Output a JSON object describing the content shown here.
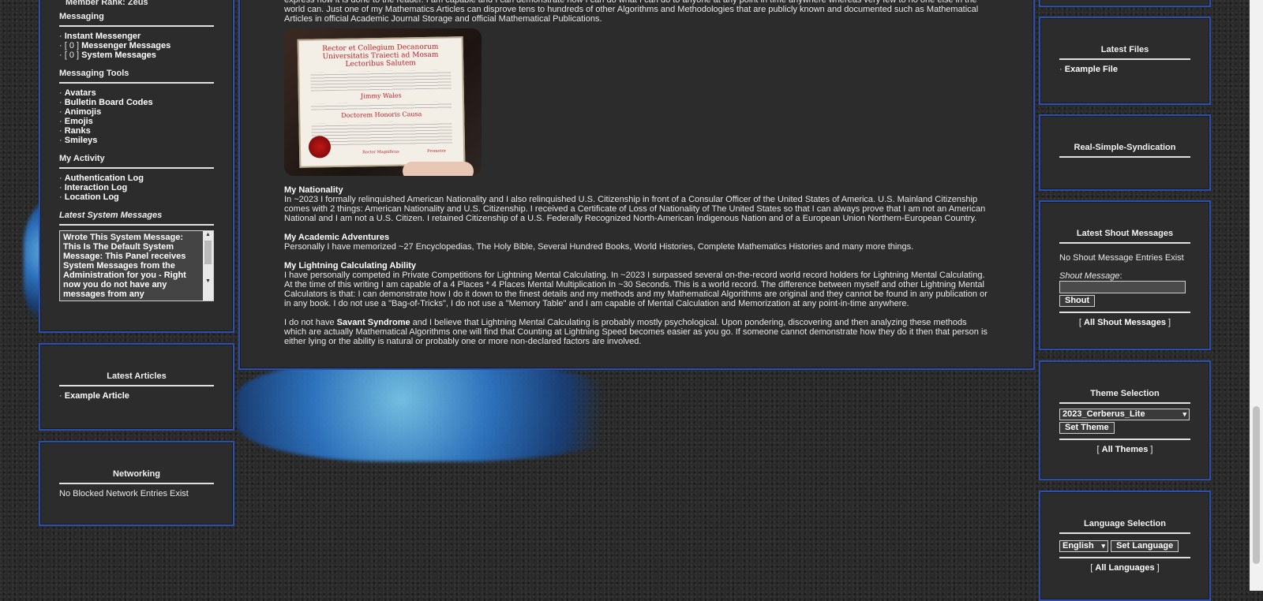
{
  "left": {
    "user_panel": {
      "member_rank": "Member Rank: Zeus",
      "messaging_title": "Messaging",
      "messaging_items": [
        {
          "prefix": "· ",
          "label": "Instant Messenger"
        },
        {
          "prefix": "· [ 0 ] ",
          "label": "Messenger Messages"
        },
        {
          "prefix": "· [ 0 ] ",
          "label": "System Messages"
        }
      ],
      "tools_title": "Messaging Tools",
      "tools_items": [
        "Avatars",
        "Bulletin Board Codes",
        "Animojis",
        "Emojis",
        "Ranks",
        "Smileys"
      ],
      "activity_title": "My Activity",
      "activity_items": [
        "Authentication Log",
        "Interaction Log",
        "Location Log"
      ],
      "system_messages_title": "Latest System Messages",
      "system_message_text": "Wrote This System Message: This Is The Default System Message: This Panel receives System Messages from the Administration for you - Right now you do not have any messages from any"
    },
    "articles": {
      "title": "Latest Articles",
      "item": "Example Article"
    },
    "networking": {
      "title": "Networking",
      "text": "No Blocked Network Entries Exist"
    }
  },
  "main": {
    "intro": "express how it is done to the reader. I am capable and I can demonstrate how I can do what I can do to anyone at any point in time anywhere whereas very few to no one else in the world can. Just one of my Mathematics Articles can disprove tens to hundreds of other Algorithms and Methodologies that are publicly known and documented such as Mathematical Articles in official Academic Journal Storage and official Mathematical Publications.",
    "diploma": {
      "line1": "Rector et Collegium Decanorum",
      "line2": "Universitatis Traiecti ad Mosam",
      "line3": "Lectoribus Salutem",
      "name": "Jimmy Wales",
      "degree": "Doctorem Honoris Causa",
      "sig_left": "Rector Magnificus",
      "sig_right": "Promotor"
    },
    "nationality_title": "My Nationality",
    "nationality_text": "In ~2023 I formally relinquished American Nationality and I also relinquished U.S. Citizenship in front of a Consular Officer of the United States of America. U.S. Mainland Citizenship comes with 2 things: American Nationality and U.S. Citizenship. I received a Certificate of Loss of Nationality of The United States so that I can always prove that I am not an American National and I am not a U.S. Citizen. I retained Citizenship of a U.S. Federally Recognized North-American Indigenous Nation and of a European Union Northern-European Country.",
    "academic_title": "My Academic Adventures",
    "academic_text": "Personally I have memorized ~27 Encyclopedias, The Holy Bible, Several Hundred Books, World Histories, Complete Mathematics Histories and many more things.",
    "lightning_title": "My Lightning Calculating Ability",
    "lightning_text": "I have personally competed in Private Competitions for Lightning Mental Calculating. In ~2023 I surpassed several on-the-record world record holders for Lightning Mental Calculating. At the time of this writing I am capable of a 4 Places * 4 Places Mental Multiplication In ~30 Seconds. This is a world record. The difference between myself and other Lightning Mental Calculators is that: I can demonstrate how I do it down to the finest details and my methods and my Mathematical Algorithms are original and they cannot be found in any publication or in any book. I do not use a \"Bag-of-Tricks\", I do not use a \"Memory Table\" and I am capable of Mental Calculation and Memorization at any point-in-time anywhere.",
    "savant_pre": "I do not have ",
    "savant_bold": "Savant Syndrome",
    "savant_post": " and I believe that Lightning Mental Calculating is probably mostly psychological. Upon pondering, discovering and then analyzing these methods which are actually Mathematical Algorithms one will find that Counting at Lightning Speed becomes easier as you go. If someone cannot demonstrate how they do it then that person is either lying or the ability is natural or probably one or more non-declared factors are involved."
  },
  "right": {
    "files": {
      "title": "Latest Files",
      "item": "Example File"
    },
    "rss": {
      "title": "Real-Simple-Syndication"
    },
    "shout": {
      "title": "Latest Shout Messages",
      "empty": "No Shout Message Entries Exist",
      "label": "Shout Message",
      "button": "Shout",
      "all_link": "All Shout Messages"
    },
    "theme": {
      "title": "Theme Selection",
      "selected": "2023_Cerberus_Lite",
      "button": "Set Theme",
      "all_link": "All Themes"
    },
    "language": {
      "title": "Language Selection",
      "selected": "English",
      "button": "Set Language",
      "all_link": "All Languages"
    }
  },
  "colors": {
    "panel_border": "#2a4fb0",
    "panel_bg": "#2c2c2c",
    "text": "#e8e8e8"
  }
}
